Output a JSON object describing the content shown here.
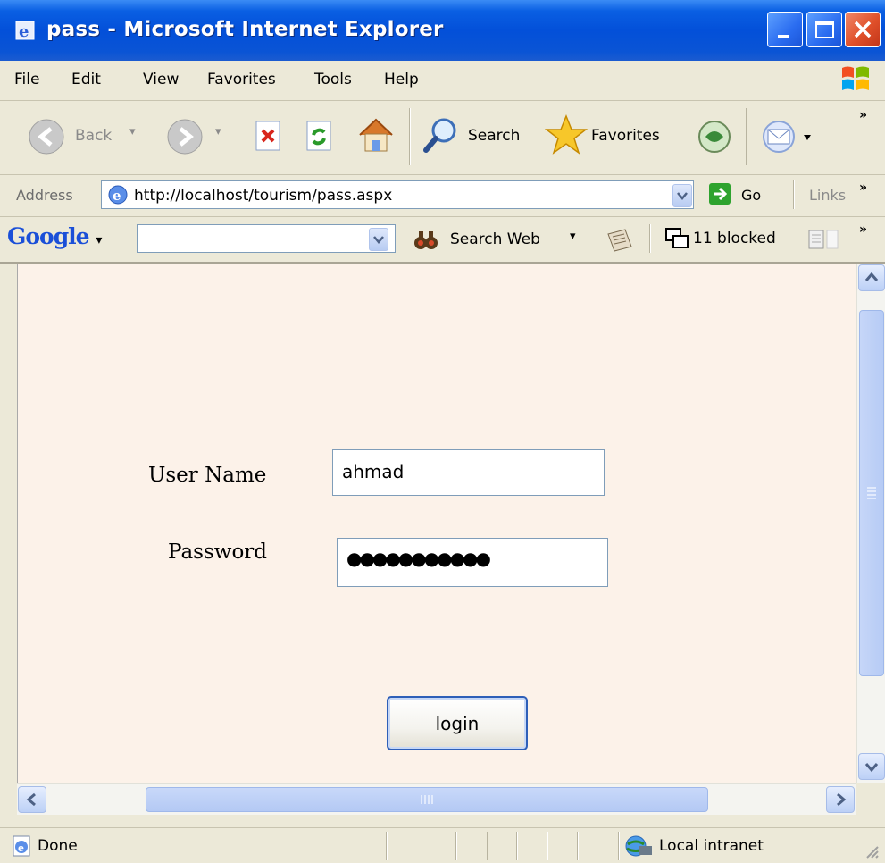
{
  "window": {
    "title": "pass - Microsoft Internet Explorer"
  },
  "menu": {
    "items": [
      "File",
      "Edit",
      "View",
      "Favorites",
      "Tools",
      "Help"
    ]
  },
  "toolbar": {
    "back_label": "Back",
    "search_label": "Search",
    "favorites_label": "Favorites"
  },
  "address": {
    "label": "Address",
    "url": "http://localhost/tourism/pass.aspx",
    "go_label": "Go",
    "links_label": "Links"
  },
  "google_toolbar": {
    "logo": "Google",
    "search_value": "",
    "search_web_label": "Search Web",
    "blocked_label": "11 blocked"
  },
  "form": {
    "username_label": "User Name",
    "username_value": "ahmad",
    "password_label": "Password",
    "password_mask": "●●●●●●●●●●●",
    "login_label": "login"
  },
  "status": {
    "text": "Done",
    "zone": "Local intranet"
  }
}
